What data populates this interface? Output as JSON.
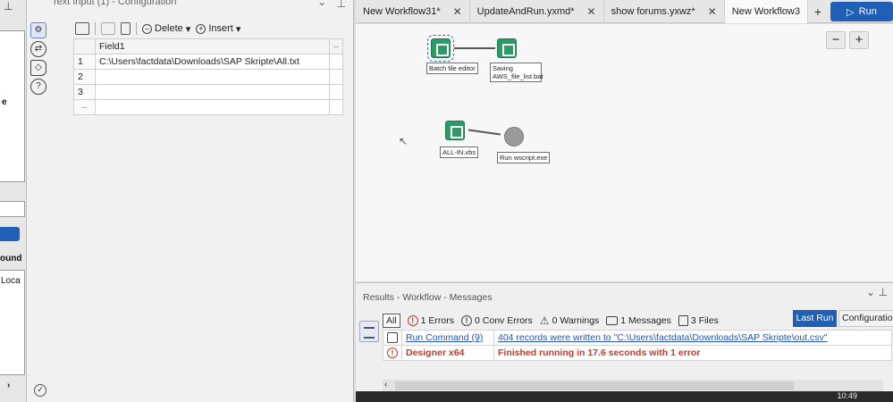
{
  "left_strip": {
    "text_e": "e",
    "text_bound": "ound",
    "text_loca": "Loca"
  },
  "config": {
    "title": "Text Input (1) - Configuration",
    "toolbar": {
      "delete_label": "Delete",
      "insert_label": "Insert"
    },
    "grid": {
      "header": "Field1",
      "rows": [
        {
          "num": "1",
          "value": "C:\\Users\\factdata\\Downloads\\SAP Skripte\\All.txt"
        },
        {
          "num": "2",
          "value": ""
        },
        {
          "num": "3",
          "value": ""
        },
        {
          "num": "",
          "value": ""
        }
      ]
    }
  },
  "tabs": [
    {
      "label": "New Workflow31*"
    },
    {
      "label": "UpdateAndRun.yxmd*"
    },
    {
      "label": "show forums.yxwz*"
    },
    {
      "label": "New Workflow3"
    }
  ],
  "run_label": "Run",
  "canvas": {
    "tools": [
      {
        "label": "Batch file editor"
      },
      {
        "label": "Saving AWS_file_list.bat"
      },
      {
        "label": "ALL-IN.vbs"
      },
      {
        "label": "Run wscript.exe"
      }
    ]
  },
  "results": {
    "title": "Results - Workflow - Messages",
    "filters": {
      "all": "All",
      "errors": "1 Errors",
      "conv_errors": "0 Conv Errors",
      "warnings": "0 Warnings",
      "messages": "1 Messages",
      "files": "3 Files"
    },
    "last_run": "Last Run",
    "configuration": "Configuration",
    "messages": [
      {
        "source": "Run Command (9)",
        "text": "404 records were written to \"C:\\Users\\factdata\\Downloads\\SAP Skripte\\out.csv\""
      },
      {
        "source": "Designer x64",
        "text": "Finished running in 17.6 seconds with 1 error"
      }
    ]
  },
  "taskbar": {
    "time": "10:49"
  }
}
